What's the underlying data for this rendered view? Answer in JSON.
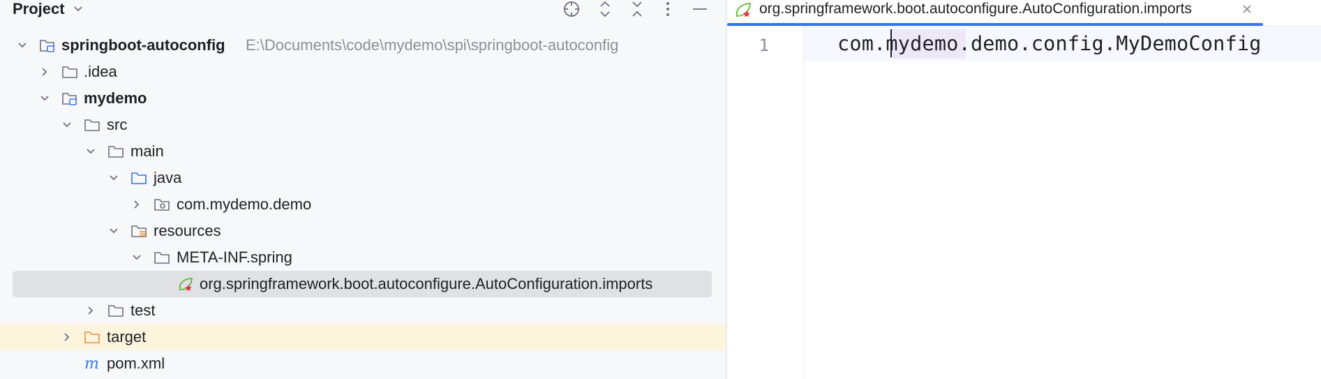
{
  "panel": {
    "title": "Project",
    "toolbar": {
      "locate": "crosshair-icon",
      "expand": "expand-all-icon",
      "collapse": "collapse-all-icon",
      "options": "more-vertical-icon",
      "hide": "minimize-icon"
    }
  },
  "tree": [
    {
      "label": "springboot-autoconfig",
      "path": "E:\\Documents\\code\\mydemo\\spi\\springboot-autoconfig",
      "icon": "module-folder-icon",
      "arrow": "chevron-down-icon"
    },
    {
      "label": ".idea",
      "icon": "folder-icon",
      "arrow": "chevron-right-icon"
    },
    {
      "label": "mydemo",
      "icon": "module-folder-icon",
      "arrow": "chevron-down-icon"
    },
    {
      "label": "src",
      "icon": "folder-icon",
      "arrow": "chevron-down-icon"
    },
    {
      "label": "main",
      "icon": "folder-icon",
      "arrow": "chevron-down-icon"
    },
    {
      "label": "java",
      "icon": "source-folder-icon",
      "arrow": "chevron-down-icon"
    },
    {
      "label": "com.mydemo.demo",
      "icon": "package-icon",
      "arrow": "chevron-right-icon"
    },
    {
      "label": "resources",
      "icon": "resources-folder-icon",
      "arrow": "chevron-down-icon"
    },
    {
      "label": "META-INF.spring",
      "icon": "folder-icon",
      "arrow": "chevron-down-icon"
    },
    {
      "label": "org.springframework.boot.autoconfigure.AutoConfiguration.imports",
      "icon": "spring-file-icon",
      "selected": true
    },
    {
      "label": "test",
      "icon": "folder-icon",
      "arrow": "chevron-right-icon"
    },
    {
      "label": "target",
      "icon": "excluded-folder-icon",
      "arrow": "chevron-right-icon",
      "excluded": true
    },
    {
      "label": "pom.xml",
      "icon": "maven-file-icon"
    }
  ],
  "editor": {
    "tab": {
      "label": "org.springframework.boot.autoconfigure.AutoConfiguration.imports",
      "icon": "spring-file-icon",
      "close": "close-icon"
    },
    "lines": [
      {
        "number": "1",
        "text": "com.mydemo.demo.config.MyDemoConfig"
      }
    ]
  },
  "colors": {
    "accent": "#3574f0",
    "selected_row": "#dfe1e5",
    "excluded_row": "#fdf4de",
    "excluded_folder": "#e88f3b",
    "source_folder": "#3574f0",
    "spring_green": "#5fb832",
    "spring_red": "#e0324a"
  }
}
